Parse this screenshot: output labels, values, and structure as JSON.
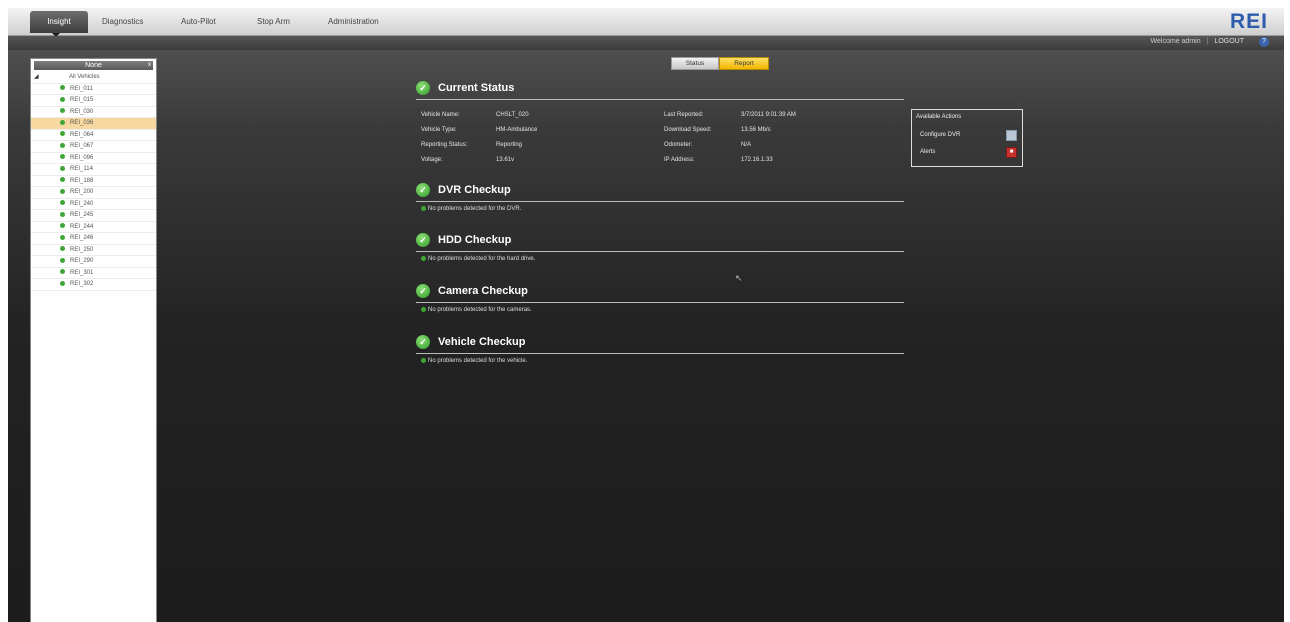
{
  "nav": {
    "tabs": [
      "Insight",
      "Diagnostics",
      "Auto-Pilot",
      "Stop Arm",
      "Administration"
    ],
    "logo": "REI"
  },
  "userbar": {
    "welcome": "Welcome admin",
    "logout": "LOGOUT",
    "help": "?"
  },
  "sidebar": {
    "header": "None",
    "close": "x",
    "root": {
      "expander": "◢",
      "label": "All Vehicles"
    },
    "vehicles": [
      "REI_011",
      "REI_015",
      "REI_030",
      "REI_036",
      "REI_064",
      "REI_067",
      "REI_096",
      "REI_114",
      "REI_188",
      "REI_200",
      "REI_240",
      "REI_245",
      "REI_244",
      "REI_246",
      "REI_250",
      "REI_290",
      "REI_301",
      "REI_302"
    ],
    "selected_index": 3
  },
  "buttons": {
    "status": "Status",
    "report": "Report"
  },
  "current_status": {
    "title": "Current Status",
    "left": [
      {
        "label": "Vehicle Name:",
        "value": "CHSLT_020"
      },
      {
        "label": "Vehicle Type:",
        "value": "HM-Ambulance"
      },
      {
        "label": "Reporting Status:",
        "value": "Reporting"
      },
      {
        "label": "Voltage:",
        "value": "13.61v"
      }
    ],
    "right": [
      {
        "label": "Last Reported:",
        "value": "3/7/2011 9:01:39 AM"
      },
      {
        "label": "Download Speed:",
        "value": "13.56 Mb/s"
      },
      {
        "label": "Odometer:",
        "value": "N/A"
      },
      {
        "label": "IP Address:",
        "value": "172.16.1.33"
      }
    ]
  },
  "actions": {
    "header": "Available Actions",
    "configure": "Configure DVR",
    "alerts": "Alerts"
  },
  "checkups": [
    {
      "title": "DVR Checkup",
      "note": "No problems detected for the DVR."
    },
    {
      "title": "HDD Checkup",
      "note": "No problems detected for the hard drive."
    },
    {
      "title": "Camera Checkup",
      "note": "No problems detected for the cameras."
    },
    {
      "title": "Vehicle Checkup",
      "note": "No problems detected for the vehicle."
    }
  ],
  "colors": {
    "accent": "#f2b600",
    "ok": "#3fa535",
    "brand": "#2c5cab",
    "selected": "#f7d8a0"
  }
}
